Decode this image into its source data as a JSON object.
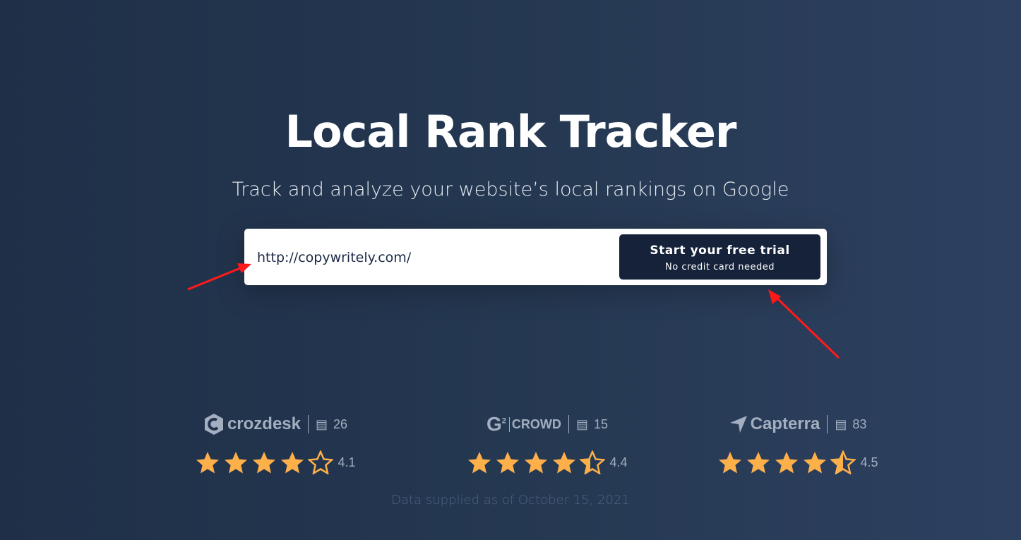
{
  "header": {
    "title": "Local Rank Tracker",
    "subtitle": "Track and analyze your website’s local rankings on Google"
  },
  "form": {
    "url_value": "http://copywritely.com/",
    "cta_label": "Start your free trial",
    "cta_sublabel": "No credit card needed"
  },
  "colors": {
    "star": "#fdb04a",
    "annotation_arrow": "#ff1a1a",
    "button": "#15223a"
  },
  "reviews": [
    {
      "source": "crozdesk",
      "count": "26",
      "rating": "4.1",
      "rating_value": 4.1
    },
    {
      "source": "CROWD",
      "count": "15",
      "rating": "4.4",
      "rating_value": 4.4
    },
    {
      "source": "Capterra",
      "count": "83",
      "rating": "4.5",
      "rating_value": 4.5
    }
  ],
  "footer": {
    "note": "Data supplied as of October 15, 2021"
  }
}
